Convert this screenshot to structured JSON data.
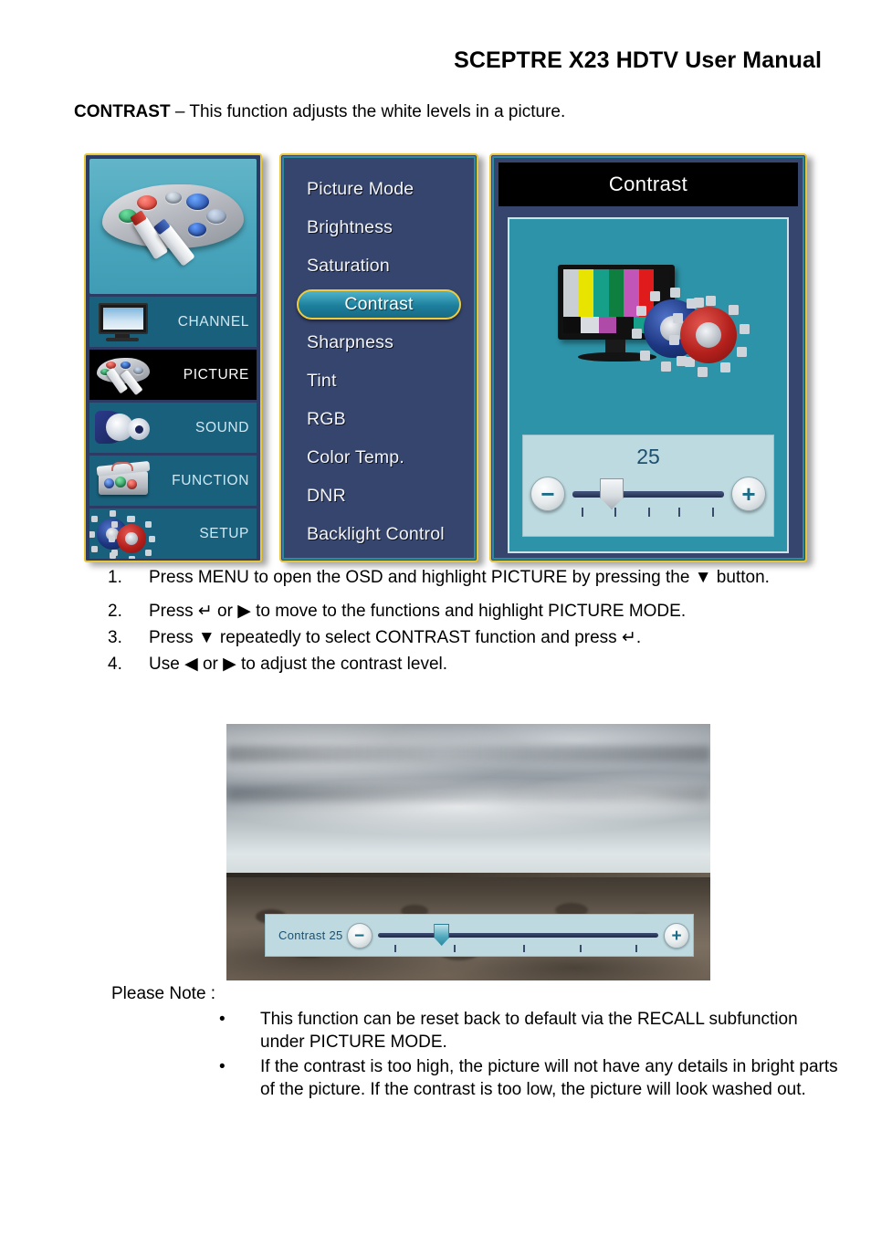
{
  "header": {
    "title": "SCEPTRE X23 HDTV User Manual"
  },
  "intro": {
    "term": "CONTRAST",
    "rest": " – This function adjusts the white levels in a picture."
  },
  "osd": {
    "sidebar": {
      "hero_icon": "paint-palette-icon",
      "items": [
        {
          "label": "CHANNEL",
          "icon": "tv-icon",
          "selected": false
        },
        {
          "label": "PICTURE",
          "icon": "palette-icon",
          "selected": true
        },
        {
          "label": "SOUND",
          "icon": "speaker-icon",
          "selected": false
        },
        {
          "label": "FUNCTION",
          "icon": "toolbox-icon",
          "selected": false
        },
        {
          "label": "SETUP",
          "icon": "gears-icon",
          "selected": false
        }
      ]
    },
    "menu": {
      "items": [
        "Picture Mode",
        "Brightness",
        "Saturation",
        "Contrast",
        "Sharpness",
        "Tint",
        "RGB",
        "Color Temp.",
        "DNR",
        "Backlight Control"
      ],
      "highlighted": "Contrast"
    },
    "detail": {
      "title": "Contrast",
      "illustration": "monitor-colorbars-gears-icon",
      "slider": {
        "value": "25",
        "minus_label": "−",
        "plus_label": "+",
        "min": 0,
        "max": 100,
        "tick_count": 5,
        "knob_percent": 25
      }
    },
    "colors": {
      "panel_bg": "#36456d",
      "panel_border": "#e8c63a",
      "panel_inner_border": "#2b8ca0",
      "sidebar_item_bg": "#18607c",
      "sidebar_selected_bg": "#000000",
      "detail_body_bg": "#2d93a8",
      "slider_box_bg": "#bcdae0",
      "highlight_pill": "#1c7f9c",
      "title_bar_bg": "#000000"
    }
  },
  "steps": [
    {
      "num": "1.",
      "text": "Press MENU to open the OSD and highlight PICTURE by pressing the ▼ button."
    },
    {
      "num": "2.",
      "text": "Press ↵ or ▶ to move to the functions and highlight PICTURE MODE."
    },
    {
      "num": "3.",
      "text": "Press ▼ repeatedly to select CONTRAST function and press ↵."
    },
    {
      "num": "4.",
      "text": "Use ◀ or ▶ to adjust the contrast level."
    }
  ],
  "photo": {
    "description": "desert-landscape-photo",
    "overlay": {
      "label": "Contrast  25",
      "minus_label": "−",
      "plus_label": "+",
      "tick_count": 5,
      "knob_percent": 25
    }
  },
  "notes": {
    "label": "Please Note :",
    "bullet": "•",
    "items": [
      "This function can be reset back to default via the RECALL subfunction under PICTURE MODE.",
      "If the contrast is too high, the picture will not have any details in bright parts of the picture.  If the contrast is too low, the picture will look washed out."
    ]
  }
}
